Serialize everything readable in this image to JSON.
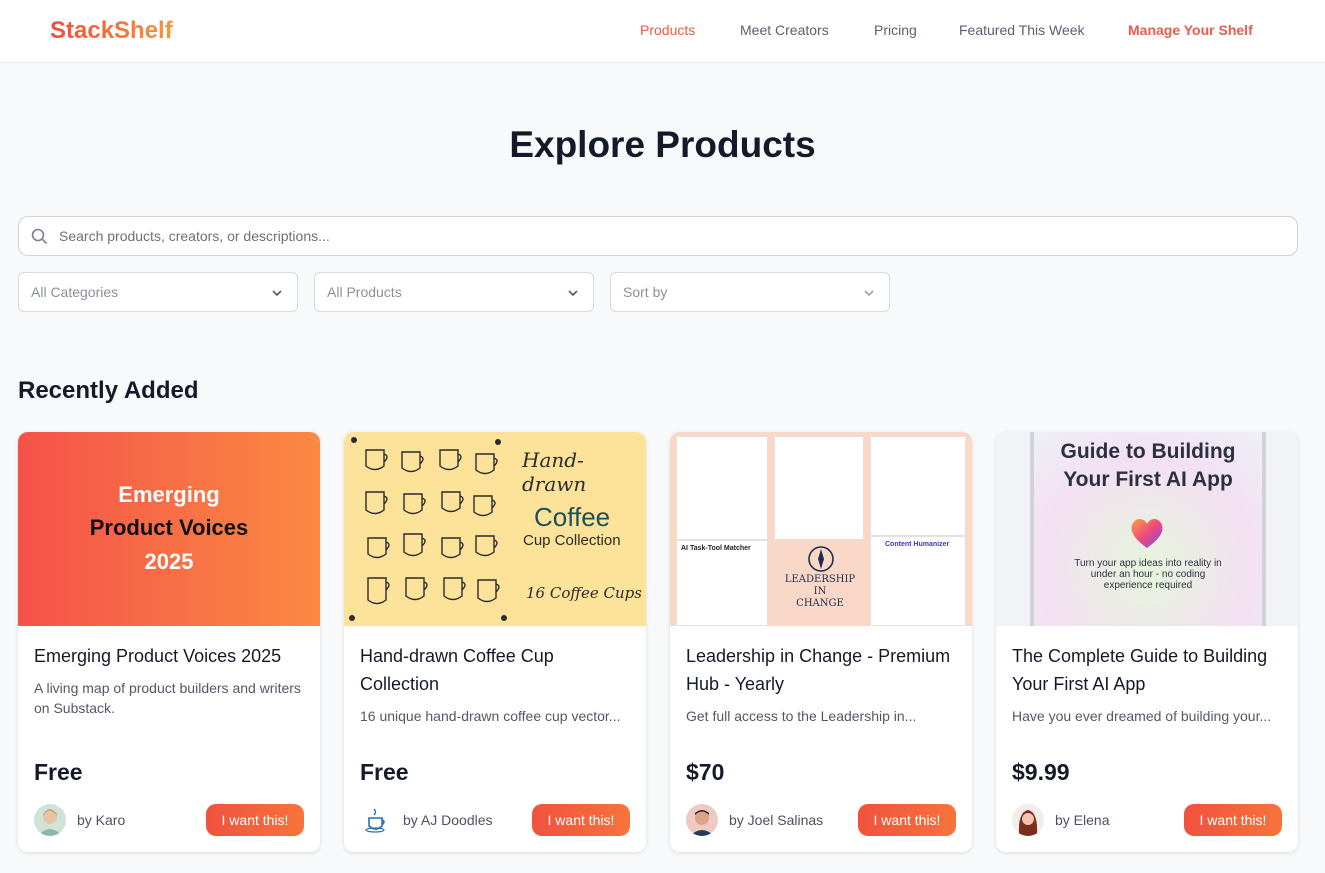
{
  "brand": {
    "name": "StackShelf"
  },
  "nav": [
    {
      "label": "Products"
    },
    {
      "label": "Meet Creators"
    },
    {
      "label": "Pricing"
    },
    {
      "label": "Featured This Week"
    },
    {
      "label": "Manage Your Shelf"
    }
  ],
  "page": {
    "title": "Explore Products"
  },
  "search": {
    "placeholder": "Search products, creators, or descriptions..."
  },
  "filters": [
    {
      "label": "All Categories"
    },
    {
      "label": "All Products"
    },
    {
      "label": "Sort by"
    }
  ],
  "section": {
    "title": "Recently Added"
  },
  "cards": [
    {
      "title": "Emerging Product Voices 2025",
      "description": "A living map of product builders and writers on Substack.",
      "price": "Free",
      "creator": "by Karo",
      "cta": "I want this!",
      "thumb": [
        "Emerging",
        "Product Voices",
        "2025"
      ]
    },
    {
      "title": "Hand-drawn Coffee Cup Collection",
      "description": "16 unique hand-drawn coffee cup vector...",
      "price": "Free",
      "creator": "by AJ Doodles",
      "cta": "I want this!",
      "thumb": [
        "Hand-drawn",
        "Coffee",
        "Cup Collection",
        "16 Coffee Cups"
      ]
    },
    {
      "title": "Leadership in Change - Premium Hub - Yearly",
      "description": "Get full access to the Leadership in...",
      "price": "$70",
      "creator": "by Joel Salinas",
      "cta": "I want this!",
      "thumb": [
        "LEADERSHIP",
        "IN",
        "CHANGE",
        "AI Task-Tool Matcher",
        "Content Humanizer"
      ]
    },
    {
      "title": "The Complete Guide to Building Your First AI App",
      "description": "Have you ever dreamed of building your...",
      "price": "$9.99",
      "creator": "by Elena",
      "cta": "I want this!",
      "thumb": [
        "Guide to Building",
        "Your First AI App",
        "Turn your app ideas into reality in",
        "under an hour - no coding",
        "experience required"
      ]
    }
  ],
  "colors": {
    "accent": "#f05a3a",
    "cta_start": "#f0523e",
    "cta_end": "#f7733c"
  }
}
